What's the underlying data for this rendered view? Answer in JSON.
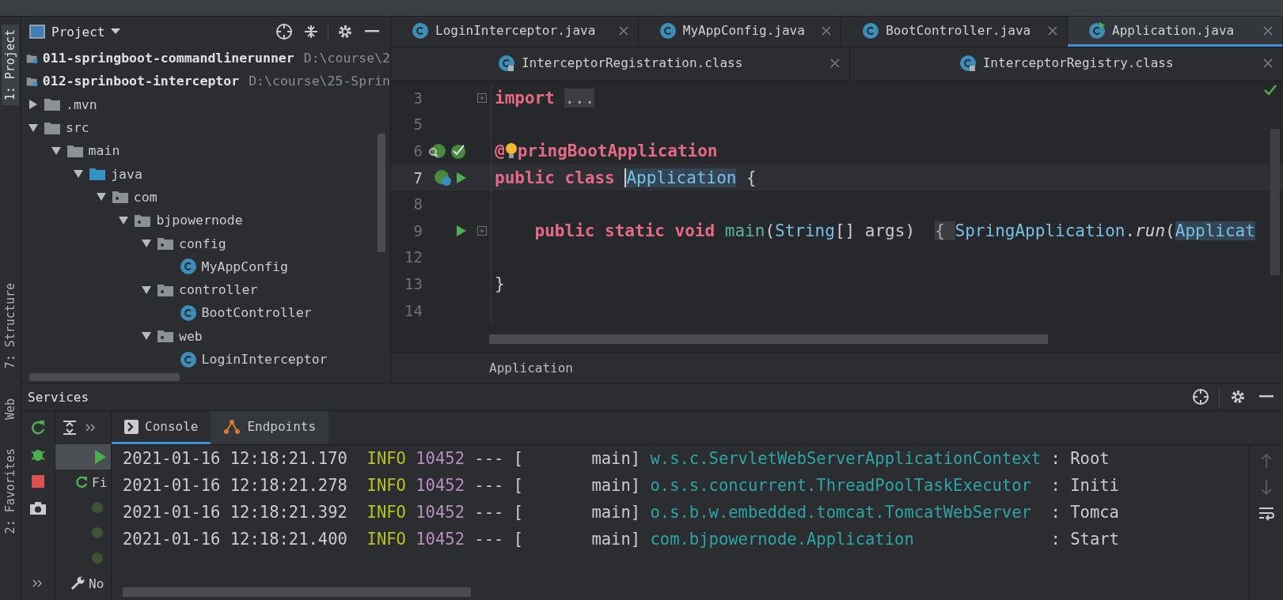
{
  "left_stripe": {
    "top": [
      {
        "label": "1: Project",
        "selected": true
      },
      {
        "label": "7: Structure",
        "selected": false
      }
    ],
    "bottom": [
      {
        "label": "Web",
        "selected": false
      },
      {
        "label": "2: Favorites",
        "selected": false
      }
    ]
  },
  "project_panel": {
    "title": "Project",
    "tree": [
      {
        "label": "011-springboot-commandlinerunner",
        "kind": "module",
        "path": "D:\\course\\2"
      },
      {
        "label": "012-sprinboot-interceptor",
        "kind": "module",
        "path": "D:\\course\\25-Sprin",
        "children": [
          {
            "label": ".mvn",
            "kind": "folder",
            "expanded": false
          },
          {
            "label": "src",
            "kind": "folder",
            "expanded": true,
            "children": [
              {
                "label": "main",
                "kind": "folder",
                "expanded": true,
                "children": [
                  {
                    "label": "java",
                    "kind": "source-folder",
                    "expanded": true,
                    "children": [
                      {
                        "label": "com",
                        "kind": "package",
                        "expanded": true,
                        "children": [
                          {
                            "label": "bjpowernode",
                            "kind": "package",
                            "expanded": true,
                            "children": [
                              {
                                "label": "config",
                                "kind": "package",
                                "expanded": true,
                                "children": [
                                  {
                                    "label": "MyAppConfig",
                                    "kind": "class"
                                  }
                                ]
                              },
                              {
                                "label": "controller",
                                "kind": "package",
                                "expanded": true,
                                "children": [
                                  {
                                    "label": "BootController",
                                    "kind": "class"
                                  }
                                ]
                              },
                              {
                                "label": "web",
                                "kind": "package",
                                "expanded": true,
                                "children": [
                                  {
                                    "label": "LoginInterceptor",
                                    "kind": "class"
                                  }
                                ]
                              }
                            ]
                          }
                        ]
                      }
                    ]
                  }
                ]
              }
            ]
          }
        ]
      }
    ]
  },
  "editor": {
    "tabs": [
      {
        "label": "LoginInterceptor.java",
        "kind": "class",
        "selected": false
      },
      {
        "label": "MyAppConfig.java",
        "kind": "class",
        "selected": false
      },
      {
        "label": "BootController.java",
        "kind": "class",
        "selected": false
      },
      {
        "label": "Application.java",
        "kind": "run-class",
        "selected": true
      }
    ],
    "tabs_row2": [
      {
        "label": "InterceptorRegistration.class",
        "kind": "locked-class",
        "selected": false
      },
      {
        "label": "InterceptorRegistry.class",
        "kind": "locked-class",
        "selected": false
      }
    ],
    "lines": [
      {
        "number": "3",
        "current": false,
        "foldable": true,
        "tokens": [
          {
            "text": "import",
            "kind": "keyword"
          },
          {
            "text": "...",
            "kind": "fold"
          }
        ]
      },
      {
        "number": "5",
        "current": false,
        "foldable": false
      },
      {
        "number": "6",
        "current": false,
        "foldable": false,
        "gutter": [
          {
            "kind": "spring-find"
          },
          {
            "kind": "spring-check"
          }
        ],
        "tokens": [
          {
            "text": "@",
            "kind": "annotation"
          },
          {
            "kind": "bulb"
          },
          {
            "text": "pringBootApplication",
            "kind": "annotation"
          }
        ]
      },
      {
        "number": "7",
        "current": true,
        "foldable": false,
        "gutter": [
          {
            "kind": "spring-bean"
          },
          {
            "kind": "run"
          }
        ],
        "tokens": [
          {
            "text": "public class ",
            "kind": "keyword"
          },
          {
            "kind": "caret"
          },
          {
            "text": "Application",
            "kind": "class-highlight"
          },
          {
            "text": " {",
            "kind": "plain"
          }
        ]
      },
      {
        "number": "8",
        "current": false,
        "foldable": false
      },
      {
        "number": "9",
        "current": false,
        "foldable": true,
        "gutter": [
          {
            "kind": "run"
          }
        ],
        "tokens": [
          {
            "text": "    public static void ",
            "kind": "keyword"
          },
          {
            "text": "main",
            "kind": "method"
          },
          {
            "text": "(",
            "kind": "plain"
          },
          {
            "text": "String",
            "kind": "class"
          },
          {
            "text": "[] args) ",
            "kind": "plain"
          },
          {
            "text": "{ ",
            "kind": "fold"
          },
          {
            "text": "SpringApplication",
            "kind": "class"
          },
          {
            "text": ".",
            "kind": "plain"
          },
          {
            "text": "run",
            "kind": "static-call"
          },
          {
            "text": "(",
            "kind": "plain"
          },
          {
            "text": "Applicat",
            "kind": "class-highlight"
          }
        ]
      },
      {
        "number": "12",
        "current": false,
        "foldable": false
      },
      {
        "number": "13",
        "current": false,
        "foldable": false,
        "tokens": [
          {
            "text": "}",
            "kind": "plain"
          }
        ]
      },
      {
        "number": "14",
        "current": false,
        "foldable": false
      }
    ],
    "breadcrumb": "Application"
  },
  "services": {
    "title": "Services",
    "tree": [
      {
        "kind": "run",
        "selected": true
      },
      {
        "kind": "rerun",
        "label": "Fi",
        "selected": false
      },
      {
        "kind": "spring",
        "selected": false
      },
      {
        "kind": "spring",
        "selected": false
      },
      {
        "kind": "spring",
        "selected": false
      },
      {
        "kind": "wrench",
        "label": "No",
        "selected": false
      }
    ],
    "console_tabs": [
      {
        "label": "Console",
        "kind": "console",
        "selected": true
      },
      {
        "label": "Endpoints",
        "kind": "endpoints",
        "selected": false
      }
    ],
    "log": [
      {
        "time": "2021-01-16 12:18:21.170",
        "level": "INFO",
        "pid": "10452",
        "separator": "--- [",
        "thread": "main]",
        "logger": "w.s.c.ServletWebServerApplicationContext",
        "message": ": Root"
      },
      {
        "time": "2021-01-16 12:18:21.278",
        "level": "INFO",
        "pid": "10452",
        "separator": "--- [",
        "thread": "main]",
        "logger": "o.s.s.concurrent.ThreadPoolTaskExecutor",
        "message": ": Initi"
      },
      {
        "time": "2021-01-16 12:18:21.392",
        "level": "INFO",
        "pid": "10452",
        "separator": "--- [",
        "thread": "main]",
        "logger": "o.s.b.w.embedded.tomcat.TomcatWebServer",
        "message": ": Tomca"
      },
      {
        "time": "2021-01-16 12:18:21.400",
        "level": "INFO",
        "pid": "10452",
        "separator": "--- [",
        "thread": "main]",
        "logger": "com.bjpowernode.Application",
        "message": ": Start"
      }
    ]
  }
}
